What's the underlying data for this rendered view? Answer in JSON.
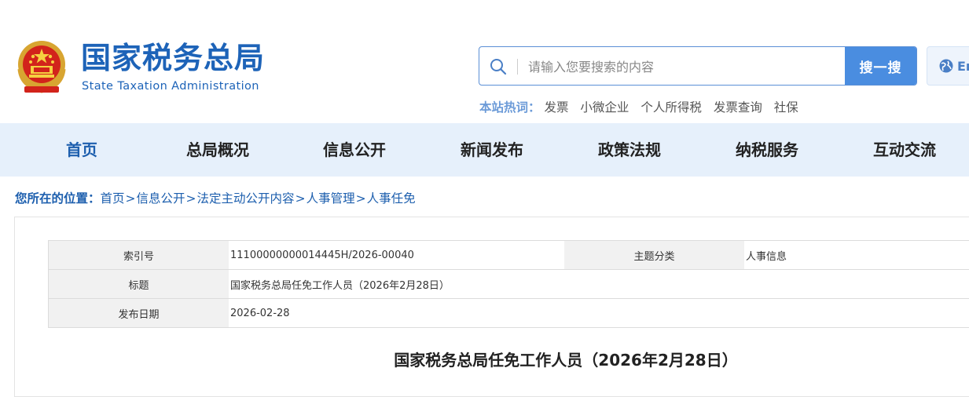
{
  "header": {
    "title": "国家税务总局",
    "subtitle": "State Taxation Administration",
    "search_placeholder": "请输入您要搜索的内容",
    "search_button": "搜一搜",
    "lang_button": "En",
    "hot_label": "本站热词：",
    "hot_words": [
      "发票",
      "小微企业",
      "个人所得税",
      "发票查询",
      "社保"
    ]
  },
  "nav": {
    "items": [
      "首页",
      "总局概况",
      "信息公开",
      "新闻发布",
      "政策法规",
      "纳税服务",
      "互动交流"
    ],
    "active": "首页"
  },
  "breadcrumb": {
    "label": "您所在的位置：",
    "items": [
      "首页",
      "信息公开",
      "法定主动公开内容",
      "人事管理",
      "人事任免"
    ],
    "separator": ">"
  },
  "meta": {
    "index_label": "索引号",
    "index_value": "11100000000014445H/2026-00040",
    "category_label": "主题分类",
    "category_value": "人事信息",
    "title_label": "标题",
    "title_value": "国家税务总局任免工作人员（2026年2月28日）",
    "date_label": "发布日期",
    "date_value": "2026-02-28"
  },
  "article": {
    "title": "国家税务总局任免工作人员（2026年2月28日）"
  },
  "colors": {
    "brand_blue": "#1d63b8",
    "nav_bg": "#e6f0fb",
    "search_button_bg": "#4a8de0"
  }
}
